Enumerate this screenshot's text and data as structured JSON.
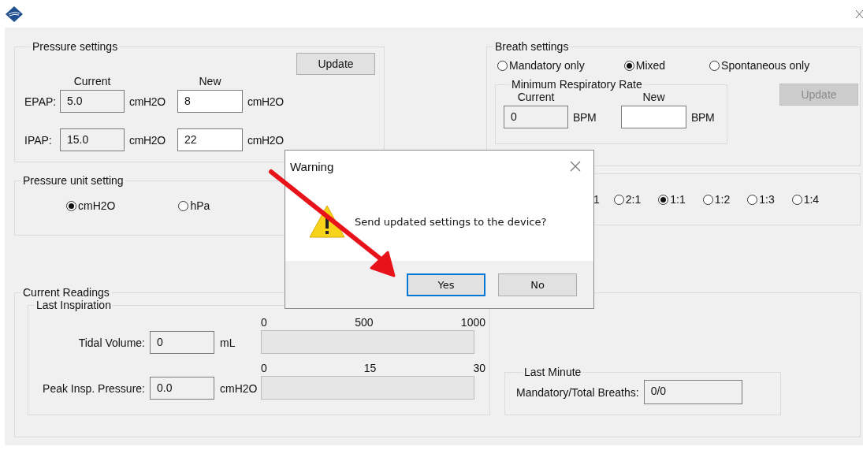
{
  "pressure_settings": {
    "title": "Pressure settings",
    "update_button": {
      "label": "Update",
      "disabled": false
    },
    "current_header": "Current",
    "new_header": "New",
    "rows": [
      {
        "label": "EPAP:",
        "current": "5.0",
        "current_unit": "cmH2O",
        "new": "8",
        "new_unit": "cmH2O"
      },
      {
        "label": "IPAP:",
        "current": "15.0",
        "current_unit": "cmH2O",
        "new": "22",
        "new_unit": "cmH2O"
      }
    ]
  },
  "pressure_unit": {
    "title": "Pressure unit setting",
    "options": [
      {
        "label": "cmH2O",
        "selected": true
      },
      {
        "label": "hPa",
        "selected": false
      }
    ]
  },
  "breath_settings": {
    "title": "Breath settings",
    "modes": [
      {
        "label": "Mandatory only",
        "selected": false
      },
      {
        "label": "Mixed",
        "selected": true
      },
      {
        "label": "Spontaneous only",
        "selected": false
      }
    ],
    "min_rate": {
      "title": "Minimum Respiratory Rate",
      "current_header": "Current",
      "new_header": "New",
      "current": "0",
      "current_unit": "BPM",
      "new_unit": "BPM"
    },
    "update_button": {
      "label": "Update",
      "disabled": true
    }
  },
  "ratio_setting": {
    "partial_label": "1",
    "options": [
      {
        "label": "2:1",
        "selected": false
      },
      {
        "label": "1:1",
        "selected": true
      },
      {
        "label": "1:2",
        "selected": false
      },
      {
        "label": "1:3",
        "selected": false
      },
      {
        "label": "1:4",
        "selected": false
      }
    ]
  },
  "current_readings": {
    "title": "Current Readings",
    "last_inspiration": {
      "title": "Last Inspiration",
      "rows": [
        {
          "label": "Tidal Volume:",
          "value": "0",
          "unit": "mL",
          "level": 0,
          "scale": [
            "0",
            "500",
            "1000"
          ]
        },
        {
          "label": "Peak Insp. Pressure:",
          "value": "0.0",
          "unit": "cmH2O",
          "level": 0,
          "scale": [
            "0",
            "15",
            "30"
          ]
        }
      ]
    },
    "last_minute": {
      "title": "Last Minute",
      "label": "Mandatory/Total Breaths:",
      "value": "0/0"
    }
  },
  "dialog": {
    "title": "Warning",
    "message": "Send updated settings to the device?",
    "buttons": [
      {
        "label": "Yes",
        "focused": true
      },
      {
        "label": "No",
        "focused": false
      }
    ]
  }
}
